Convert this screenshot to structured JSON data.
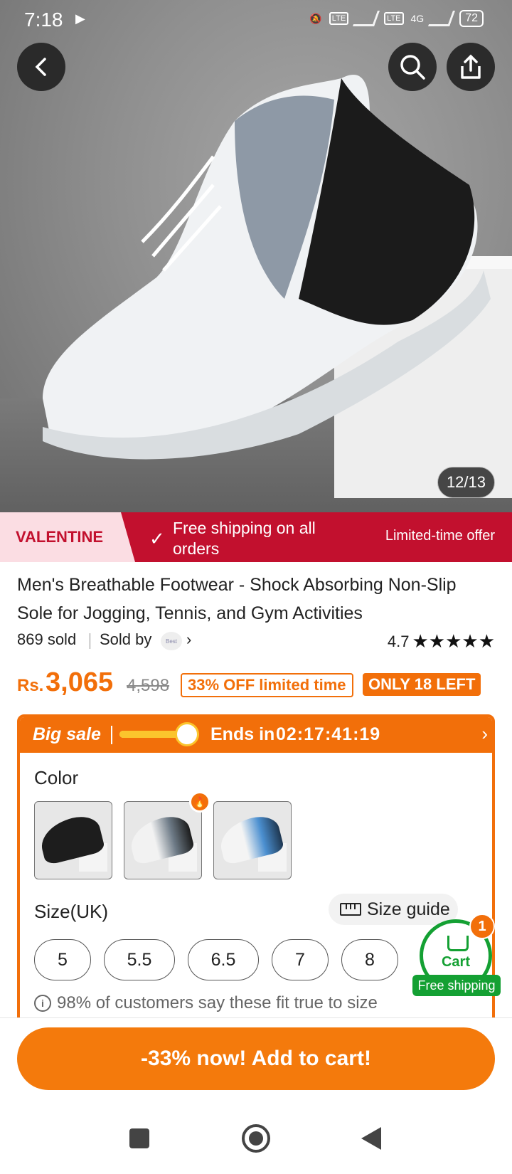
{
  "status_bar": {
    "time": "7:18",
    "battery": "72",
    "network": "4G"
  },
  "gallery": {
    "page_indicator": "12/13"
  },
  "banner": {
    "tag": "VALENTINE",
    "free_shipping": "Free shipping on all orders",
    "offer": "Limited-time offer"
  },
  "product": {
    "title": "Men's Breathable Footwear - Shock Absorbing Non-Slip Sole for Jogging, Tennis, and Gym Activities",
    "sold": "869 sold",
    "sold_by": "Sold by",
    "rating": "4.7",
    "stars_value": 4.7,
    "currency": "Rs.",
    "price": "3,065",
    "old_price": "4,598",
    "discount_badge": "33% OFF limited time",
    "stock_badge": "ONLY 18 LEFT"
  },
  "sale": {
    "title": "Big sale",
    "ends_label": "Ends in",
    "countdown": "02:17:41:19",
    "progress": 0.75
  },
  "options": {
    "color_label": "Color",
    "size_label": "Size(UK)",
    "size_guide": "Size guide",
    "sizes": [
      "5",
      "5.5",
      "6.5",
      "7",
      "8"
    ],
    "fit_note": "98% of customers say these fit true to size"
  },
  "cart": {
    "label": "Cart",
    "count": "1",
    "shipping": "Free shipping"
  },
  "cta": {
    "add_to_cart": "-33% now! Add to cart!"
  },
  "colors": {
    "accent": "#f26f0a",
    "banner": "#c2102e",
    "cart_green": "#14a033"
  }
}
